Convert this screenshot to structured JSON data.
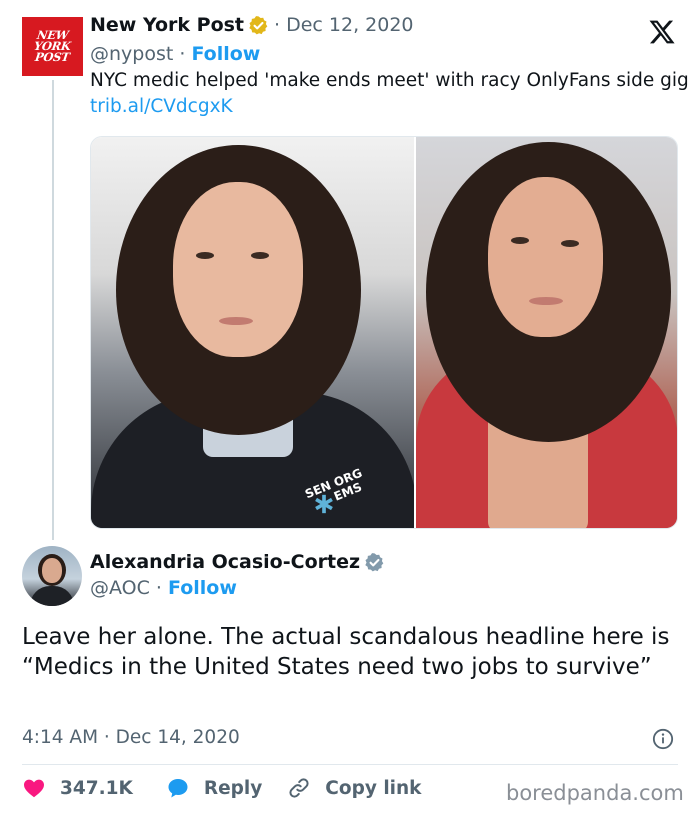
{
  "quoted": {
    "logo_lines": [
      "NEW",
      "YORK",
      "POST"
    ],
    "name": "New York Post",
    "date_separator": " · ",
    "date": "Dec 12, 2020",
    "handle": "@nypost",
    "follow_separator": " · ",
    "follow": "Follow",
    "text": "NYC medic helped 'make ends meet' with racy OnlyFans side gig ",
    "link": "trib.al/CVdcgxK",
    "media_text": [
      "SEN ORG",
      "EMS"
    ]
  },
  "tweet": {
    "name": "Alexandria Ocasio-Cortez",
    "handle": "@AOC",
    "follow_separator": " · ",
    "follow": "Follow",
    "text": "Leave her alone. The actual scandalous headline here is “Medics in the United States need two jobs to survive”",
    "timestamp": "4:14 AM · Dec 14, 2020"
  },
  "actions": {
    "likes": "347.1K",
    "reply": "Reply",
    "copy_link": "Copy link"
  },
  "watermark": "boredpanda.com",
  "colors": {
    "link_blue": "#1d9bf0",
    "like_red": "#f91880",
    "gold_badge": "#e2b719",
    "grey_badge": "#829aab",
    "nypost_red": "#d71920"
  },
  "icons": [
    "x-logo-icon",
    "gold-verified-badge-icon",
    "grey-verified-badge-icon",
    "info-icon",
    "heart-icon",
    "reply-bubble-icon",
    "link-icon"
  ]
}
